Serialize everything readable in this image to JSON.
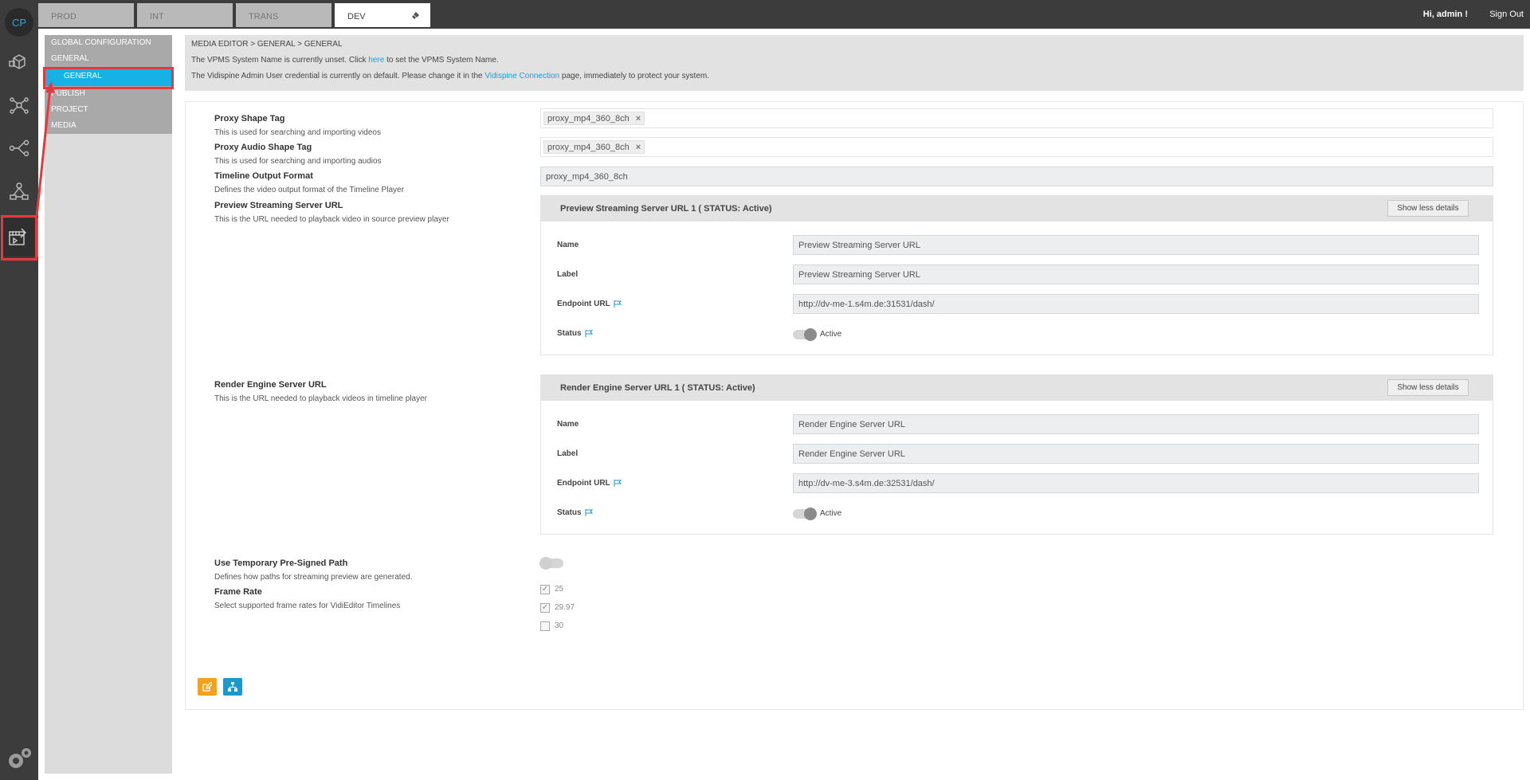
{
  "rail": {
    "logo": "CP",
    "items": [
      {
        "icon": "box-icon"
      },
      {
        "icon": "network-icon"
      },
      {
        "icon": "workflow-icon"
      },
      {
        "icon": "hierarchy-icon"
      },
      {
        "icon": "media-editor-icon"
      }
    ],
    "settings_icon": "gear-icon"
  },
  "topbar": {
    "tabs": [
      {
        "label": "PROD",
        "active": false
      },
      {
        "label": "INT",
        "active": false
      },
      {
        "label": "TRANS",
        "active": false
      },
      {
        "label": "DEV",
        "active": true
      }
    ],
    "greeting": "Hi, admin !",
    "signout": "Sign Out"
  },
  "subnav": {
    "items": [
      {
        "label": "GLOBAL CONFIGURATION"
      },
      {
        "label": "GENERAL"
      },
      {
        "label": "GENERAL",
        "active": true
      },
      {
        "label": "PUBLISH"
      },
      {
        "label": "PROJECT"
      },
      {
        "label": "MEDIA"
      }
    ]
  },
  "header": {
    "breadcrumb": "MEDIA EDITOR > GENERAL > GENERAL",
    "msg1_pre": "The VPMS System Name is currently unset. Click ",
    "msg1_link": "here",
    "msg1_post": " to set the VPMS System Name.",
    "msg2_pre": "The Vidispine Admin User credential is currently on default. Please change it in the ",
    "msg2_link": "Vidispine Connection",
    "msg2_post": " page, immediately to protect your system."
  },
  "form": {
    "proxy_shape": {
      "label": "Proxy Shape Tag",
      "desc": "This is used for searching and importing videos",
      "chip": "proxy_mp4_360_8ch"
    },
    "proxy_audio": {
      "label": "Proxy Audio Shape Tag",
      "desc": "This is used for searching and importing audios",
      "chip": "proxy_mp4_360_8ch"
    },
    "timeline_format": {
      "label": "Timeline Output Format",
      "desc": "Defines the video output format of the Timeline Player",
      "value": "proxy_mp4_360_8ch"
    },
    "preview": {
      "label": "Preview Streaming Server URL",
      "desc": "This is the URL needed to playback video in source preview player",
      "card_title": "Preview Streaming Server URL 1 ( STATUS: Active)",
      "toggle_btn": "Show less details",
      "name_label": "Name",
      "name_value": "Preview Streaming Server URL",
      "label_label": "Label",
      "label_value": "Preview Streaming Server URL",
      "endpoint_label": "Endpoint URL",
      "endpoint_value": "http://dv-me-1.s4m.de:31531/dash/",
      "status_label": "Status",
      "status_value": "Active"
    },
    "render": {
      "label": "Render Engine Server URL",
      "desc": "This is the URL needed to playback videos in timeline player",
      "card_title": "Render Engine Server URL 1 ( STATUS: Active)",
      "toggle_btn": "Show less details",
      "name_label": "Name",
      "name_value": "Render Engine Server URL",
      "label_label": "Label",
      "label_value": "Render Engine Server URL",
      "endpoint_label": "Endpoint URL",
      "endpoint_value": "http://dv-me-3.s4m.de:32531/dash/",
      "status_label": "Status",
      "status_value": "Active"
    },
    "presigned": {
      "label": "Use Temporary Pre-Signed Path",
      "desc": "Defines how paths for streaming preview are generated.",
      "enabled": false
    },
    "frame_rate": {
      "label": "Frame Rate",
      "desc": "Select supported frame rates for VidiEditor Timelines",
      "options": [
        {
          "label": "25",
          "checked": true
        },
        {
          "label": "29.97",
          "checked": true
        },
        {
          "label": "30",
          "checked": false
        }
      ]
    }
  },
  "actions": {
    "edit_icon": "edit-icon",
    "tree_icon": "sitemap-icon"
  },
  "colors": {
    "accent": "#16b1e5",
    "highlight": "#e8383d",
    "edit_button": "#f5a21b",
    "tree_button": "#1a98d0"
  }
}
